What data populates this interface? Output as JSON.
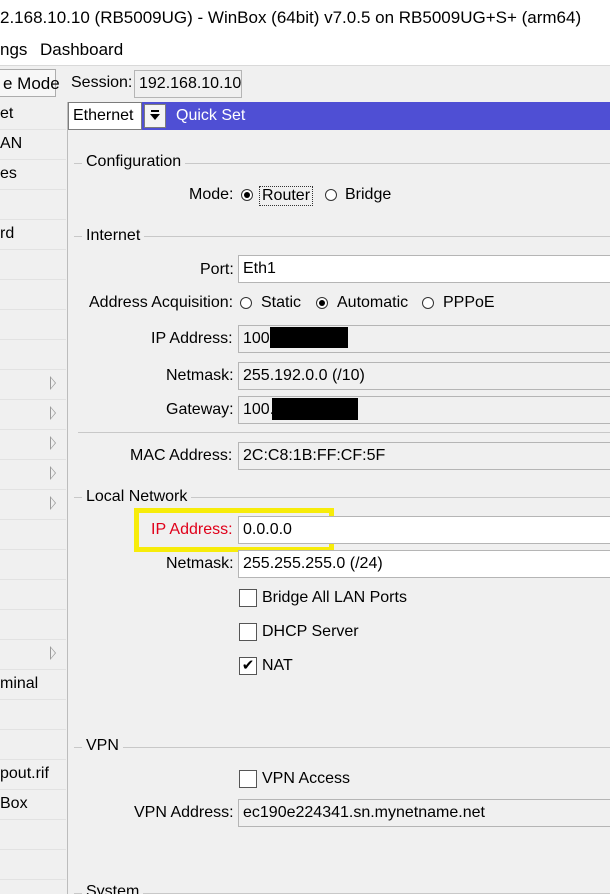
{
  "window": {
    "title": "2.168.10.10 (RB5009UG) - WinBox (64bit) v7.0.5 on RB5009UG+S+ (arm64)"
  },
  "menu": {
    "items": [
      "ngs",
      "Dashboard"
    ]
  },
  "toolbar": {
    "mode_button": "e Mode",
    "session_label": "Session:",
    "session_value": "192.168.10.10"
  },
  "sidebar": {
    "items": [
      {
        "label": "et",
        "submenu": false
      },
      {
        "label": "AN",
        "submenu": false
      },
      {
        "label": "es",
        "submenu": false
      },
      {
        "label": "",
        "submenu": false
      },
      {
        "label": "rd",
        "submenu": false
      },
      {
        "label": "",
        "submenu": false
      },
      {
        "label": "",
        "submenu": false
      },
      {
        "label": "",
        "submenu": false
      },
      {
        "label": "",
        "submenu": false
      },
      {
        "label": "",
        "submenu": true
      },
      {
        "label": "",
        "submenu": true
      },
      {
        "label": "",
        "submenu": true
      },
      {
        "label": "",
        "submenu": true
      },
      {
        "label": "",
        "submenu": true
      },
      {
        "label": "",
        "submenu": false
      },
      {
        "label": "",
        "submenu": false
      },
      {
        "label": "",
        "submenu": false
      },
      {
        "label": "",
        "submenu": false
      },
      {
        "label": "",
        "submenu": true
      },
      {
        "label": "minal",
        "submenu": false
      },
      {
        "label": "",
        "submenu": false
      },
      {
        "label": "",
        "submenu": false
      },
      {
        "label": "pout.rif",
        "submenu": false
      },
      {
        "label": "Box",
        "submenu": false
      },
      {
        "label": "",
        "submenu": false
      },
      {
        "label": "",
        "submenu": false
      }
    ]
  },
  "quickset": {
    "interface_select": "Ethernet",
    "title": "Quick Set"
  },
  "configuration": {
    "group_title": "Configuration",
    "mode_label": "Mode:",
    "mode_options": [
      {
        "label": "Router",
        "selected": true
      },
      {
        "label": "Bridge",
        "selected": false
      }
    ]
  },
  "internet": {
    "group_title": "Internet",
    "port_label": "Port:",
    "port_value": "Eth1",
    "acquisition_label": "Address Acquisition:",
    "acquisition_options": [
      {
        "label": "Static",
        "selected": false
      },
      {
        "label": "Automatic",
        "selected": true
      },
      {
        "label": "PPPoE",
        "selected": false
      }
    ],
    "ip_label": "IP Address:",
    "ip_value": "100",
    "netmask_label": "Netmask:",
    "netmask_value": "255.192.0.0 (/10)",
    "gateway_label": "Gateway:",
    "gateway_value": "100.",
    "mac_label": "MAC Address:",
    "mac_value": "2C:C8:1B:FF:CF:5F"
  },
  "local_network": {
    "group_title": "Local Network",
    "ip_label": "IP Address:",
    "ip_value": "0.0.0.0",
    "netmask_label": "Netmask:",
    "netmask_value": "255.255.255.0 (/24)",
    "bridge_all": {
      "label": "Bridge All LAN Ports",
      "checked": false
    },
    "dhcp": {
      "label": "DHCP Server",
      "checked": false
    },
    "nat": {
      "label": "NAT",
      "checked": true
    },
    "checkmark": "✔"
  },
  "vpn": {
    "group_title": "VPN",
    "access": {
      "label": "VPN Access",
      "checked": false
    },
    "address_label": "VPN Address:",
    "address_value": "ec190e224341.sn.mynetname.net"
  },
  "system": {
    "group_title": "System"
  },
  "colors": {
    "quickset_header": "#4f4fd4",
    "highlight": "#f7ec0a",
    "error_label": "#e0001a"
  }
}
